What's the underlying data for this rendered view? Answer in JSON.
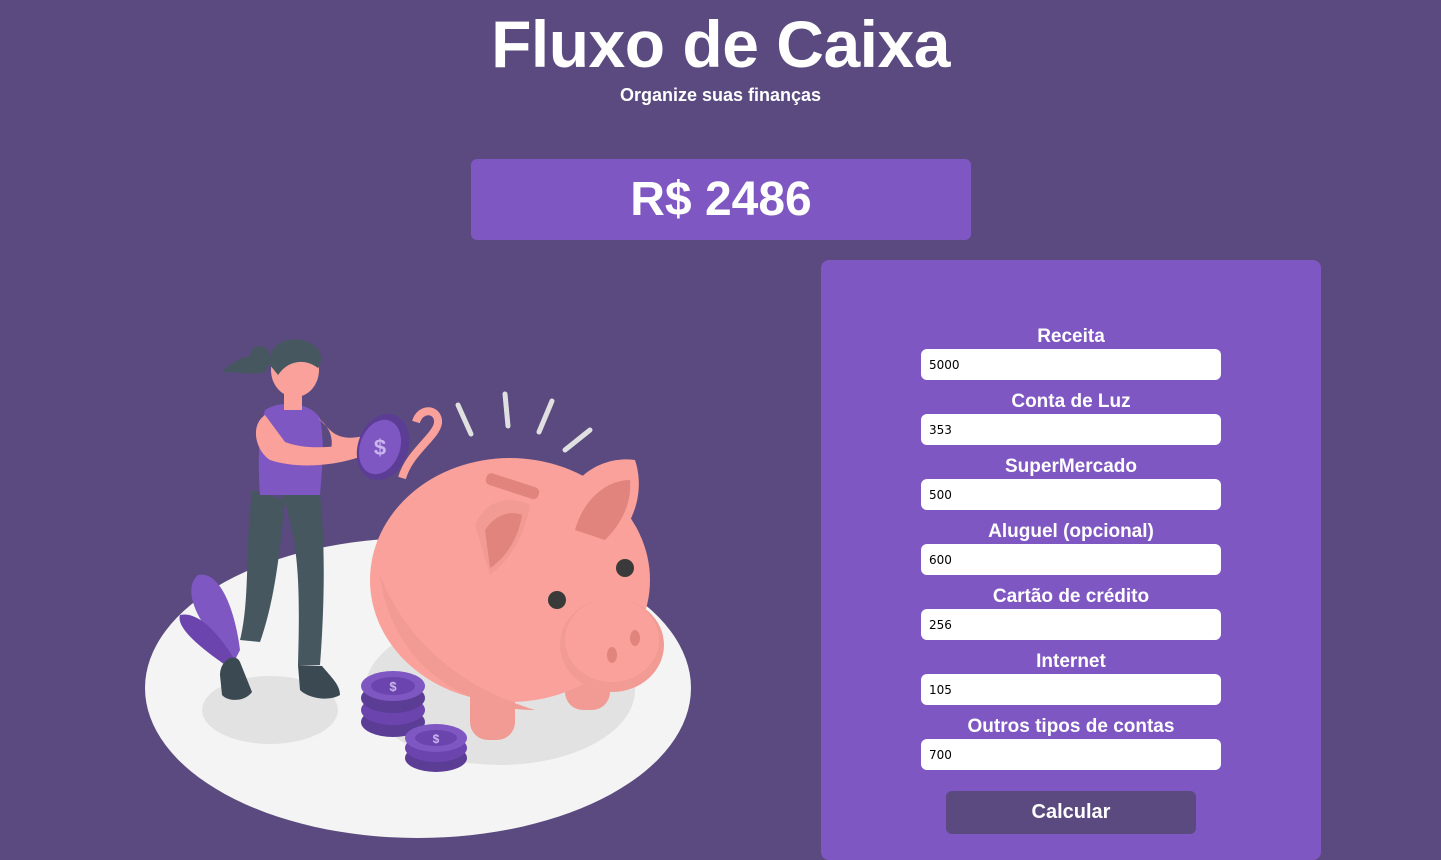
{
  "header": {
    "title": "Fluxo de Caixa",
    "subtitle": "Organize suas finanças"
  },
  "result": {
    "value": "R$ 2486"
  },
  "form": {
    "fields": [
      {
        "label": "Receita",
        "value": "5000"
      },
      {
        "label": "Conta de Luz",
        "value": "353"
      },
      {
        "label": "SuperMercado",
        "value": "500"
      },
      {
        "label": "Aluguel (opcional)",
        "value": "600"
      },
      {
        "label": "Cartão de crédito",
        "value": "256"
      },
      {
        "label": "Internet",
        "value": "105"
      },
      {
        "label": "Outros tipos de contas",
        "value": "700"
      }
    ],
    "submit_label": "Calcular"
  },
  "illustration": {
    "subject": "woman-inserting-coin-into-piggy-bank",
    "coin_symbol": "$"
  },
  "colors": {
    "background": "#5a4a7f",
    "accent": "#7f57c2",
    "input_background": "#ffffff",
    "text": "#ffffff",
    "piggy": "#f9a19a"
  }
}
